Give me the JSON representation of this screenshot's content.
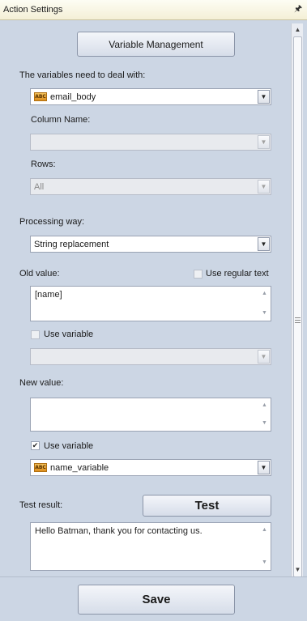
{
  "window": {
    "title": "Action Settings"
  },
  "pin_icon": "pin-icon",
  "variable_management_label": "Variable Management",
  "variables": {
    "label": "The variables need to deal with:",
    "selected": "email_body",
    "column_label": "Column Name:",
    "column_value": "",
    "rows_label": "Rows:",
    "rows_value": "All"
  },
  "processing": {
    "label": "Processing way:",
    "selected": "String replacement"
  },
  "old_value": {
    "label": "Old value:",
    "regex_label": "Use regular text",
    "regex_checked": false,
    "text": "[name]",
    "use_variable_label": "Use variable",
    "use_variable_checked": false,
    "variable_value": ""
  },
  "new_value": {
    "label": "New value:",
    "text": "",
    "use_variable_label": "Use variable",
    "use_variable_checked": true,
    "variable_value": "name_variable"
  },
  "test": {
    "label": "Test result:",
    "button_label": "Test",
    "result_text": "Hello Batman, thank you for contacting us."
  },
  "save_label": "Save",
  "icons": {
    "abc_badge": "ABC",
    "check_mark": "✔",
    "dropdown_arrow": "▼",
    "scroll_up": "▲",
    "scroll_down": "▼"
  }
}
